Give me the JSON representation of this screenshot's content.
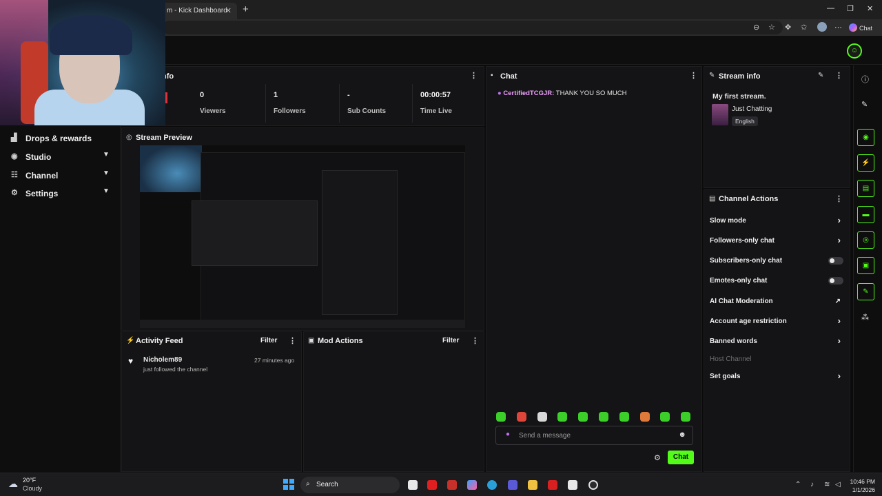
{
  "browser": {
    "tab_title": "m - Kick Dashboard",
    "new_tab": "+",
    "chat_button": "Chat"
  },
  "sidebar": {
    "items": [
      {
        "label": "Drops & rewards",
        "icon": "gift-icon"
      },
      {
        "label": "Studio",
        "icon": "studio-icon"
      },
      {
        "label": "Channel",
        "icon": "channel-icon"
      },
      {
        "label": "Settings",
        "icon": "gear-icon"
      }
    ]
  },
  "session": {
    "title_fragment": "nfo",
    "stats": [
      {
        "value": "0",
        "label": "Viewers"
      },
      {
        "value": "1",
        "label": "Followers"
      },
      {
        "value": "-",
        "label": "Sub Counts"
      },
      {
        "value": "00:00:57",
        "label": "Time Live"
      }
    ]
  },
  "stream_preview": {
    "title": "Stream Preview"
  },
  "activity_feed": {
    "title": "Activity Feed",
    "filter": "Filter",
    "items": [
      {
        "user": "Nicholem89",
        "action": "just followed the channel",
        "time": "27 minutes ago"
      }
    ]
  },
  "mod_actions": {
    "title": "Mod Actions",
    "filter": "Filter"
  },
  "chat": {
    "title": "Chat",
    "messages": [
      {
        "user": "CertifiedTCGJR:",
        "text": " THANK YOU SO MUCH"
      }
    ],
    "input_placeholder": "Send a message",
    "send_label": "Chat",
    "emote_colors": [
      "#3ccf2a",
      "#e0453a",
      "#d8d8d8",
      "#3ccf2a",
      "#3ccf2a",
      "#3ccf2a",
      "#3ccf2a",
      "#e07a3a",
      "#3ccf2a",
      "#3ccf2a"
    ]
  },
  "stream_info": {
    "title": "Stream info",
    "stream_title": "My first stream.",
    "category": "Just Chatting",
    "language": "English"
  },
  "channel_actions": {
    "title": "Channel Actions",
    "items": [
      {
        "label": "Slow mode",
        "control": "arrow"
      },
      {
        "label": "Followers-only chat",
        "control": "arrow"
      },
      {
        "label": "Subscribers-only chat",
        "control": "toggle"
      },
      {
        "label": "Emotes-only chat",
        "control": "toggle"
      },
      {
        "label": "AI Chat Moderation",
        "control": "external"
      },
      {
        "label": "Account age restriction",
        "control": "arrow"
      },
      {
        "label": "Banned words",
        "control": "arrow"
      },
      {
        "label": "Host Channel",
        "control": "none"
      },
      {
        "label": "Set goals",
        "control": "arrow"
      }
    ]
  },
  "taskbar": {
    "weather_temp": "20°F",
    "weather_desc": "Cloudy",
    "search": "Search",
    "time": "10:46 PM",
    "date": "1/1/2026"
  },
  "colors": {
    "accent": "#53fc18",
    "panel": "#141416",
    "background": "#0b0b0c"
  }
}
